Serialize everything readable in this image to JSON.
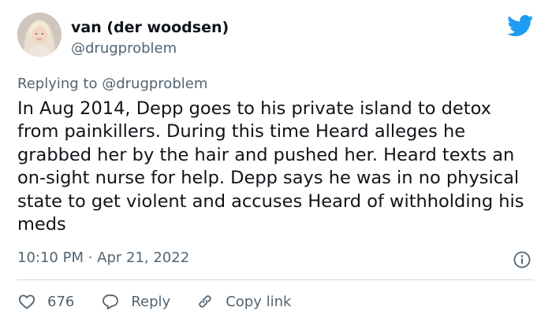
{
  "author": {
    "name": "van (der woodsen)",
    "handle": "@drugproblem"
  },
  "reply_context": {
    "prefix": "Replying to",
    "mention": "@drugproblem"
  },
  "tweet": {
    "text": "In Aug 2014, Depp goes to his private island to detox from painkillers. During this time Heard alleges he grabbed her by the hair and pushed her. Heard texts an on-sight nurse for help. Depp says he was in no physical state to get violent and accuses Heard of withholding his meds",
    "timestamp": "10:10 PM · Apr 21, 2022"
  },
  "actions": {
    "likes_count": "676",
    "reply_label": "Reply",
    "copy_link_label": "Copy link"
  },
  "icons": {
    "brand": "twitter-bird-icon",
    "info": "info-icon",
    "like": "heart-icon",
    "reply": "speech-bubble-icon",
    "copy_link": "link-icon"
  },
  "colors": {
    "brand_blue": "#1d9bf0",
    "text_primary": "#0f1419",
    "text_secondary": "#536471",
    "divider": "#cfd9de"
  }
}
